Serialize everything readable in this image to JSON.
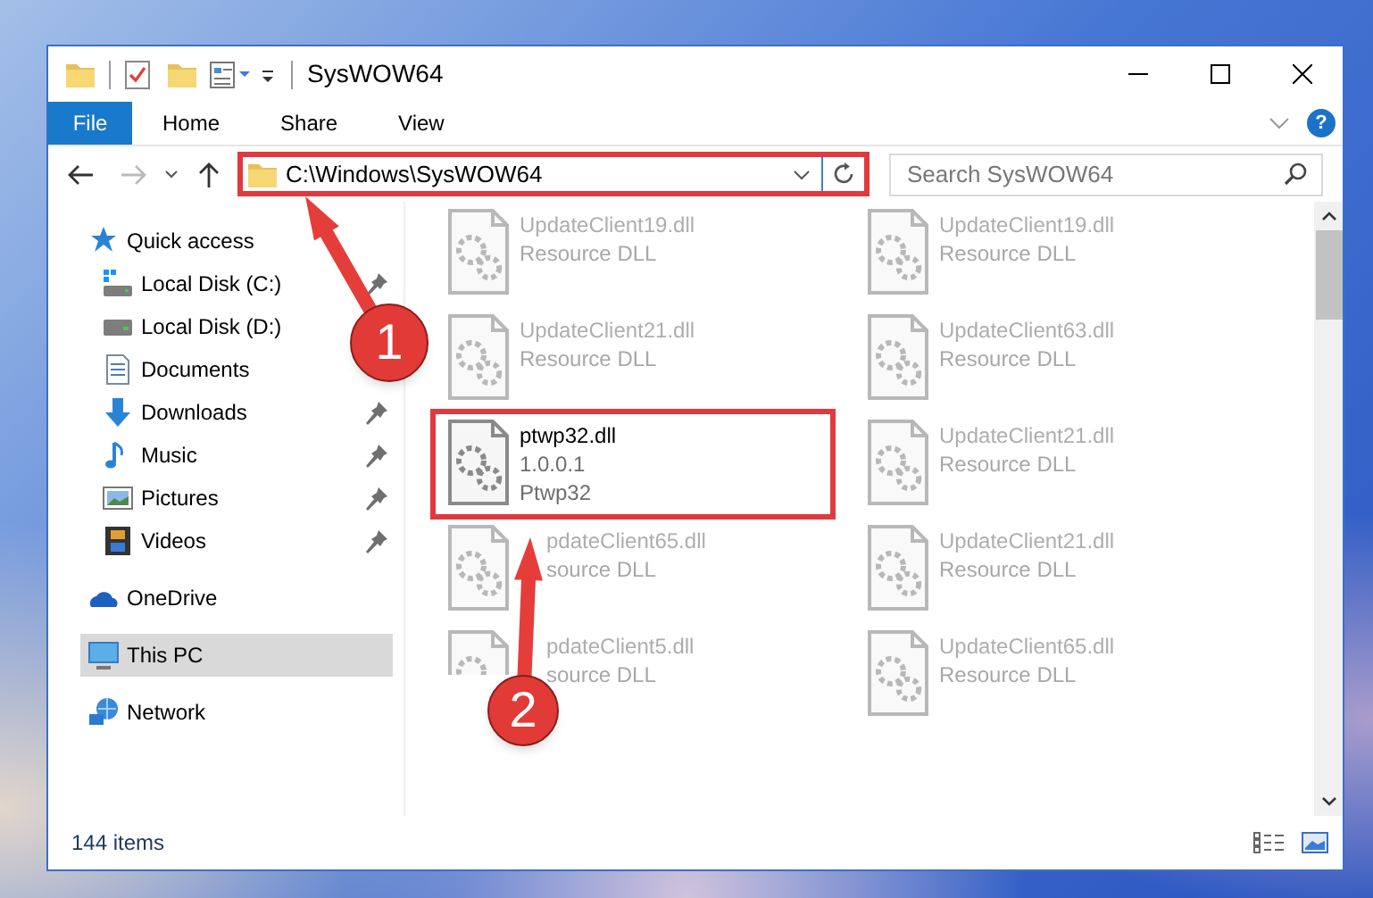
{
  "window": {
    "title": "SysWOW64",
    "help_button": "?"
  },
  "ribbon_tabs": [
    {
      "label": "File",
      "kind": "file"
    },
    {
      "label": "Home",
      "kind": "tab"
    },
    {
      "label": "Share",
      "kind": "tab"
    },
    {
      "label": "View",
      "kind": "tab"
    }
  ],
  "address_bar": {
    "path": "C:\\Windows\\SysWOW64",
    "highlighted": true
  },
  "search": {
    "placeholder": "Search SysWOW64"
  },
  "sidebar": [
    {
      "label": "Quick access",
      "kind": "star",
      "selected": false,
      "children": [
        {
          "label": "Local Disk (C:)",
          "kind": "windrive",
          "pinned": true,
          "selected": false
        },
        {
          "label": "Local Disk (D:)",
          "kind": "drive",
          "pinned": false,
          "selected": false
        },
        {
          "label": "Documents",
          "kind": "docs",
          "pinned": false,
          "selected": false
        },
        {
          "label": "Downloads",
          "kind": "download",
          "pinned": true,
          "selected": false
        },
        {
          "label": "Music",
          "kind": "music",
          "pinned": true,
          "selected": false
        },
        {
          "label": "Pictures",
          "kind": "pictures",
          "pinned": true,
          "selected": false
        },
        {
          "label": "Videos",
          "kind": "videos",
          "pinned": true,
          "selected": false
        }
      ]
    },
    {
      "label": "OneDrive",
      "kind": "cloud",
      "selected": false
    },
    {
      "label": "This PC",
      "kind": "pc",
      "selected": true
    },
    {
      "label": "Network",
      "kind": "network",
      "selected": false
    }
  ],
  "files": [
    {
      "name": "UpdateClient19.dll",
      "details": [
        "Resource DLL"
      ],
      "blurred": true,
      "highlighted": false
    },
    {
      "name": "UpdateClient19.dll",
      "details": [
        "Resource DLL"
      ],
      "blurred": true,
      "highlighted": false
    },
    {
      "name": "UpdateClient21.dll",
      "details": [
        "Resource DLL"
      ],
      "blurred": true,
      "highlighted": false
    },
    {
      "name": "UpdateClient63.dll",
      "details": [
        "Resource DLL"
      ],
      "blurred": true,
      "highlighted": false
    },
    {
      "name": "ptwp32.dll",
      "details": [
        "1.0.0.1",
        "Ptwp32"
      ],
      "blurred": false,
      "highlighted": true
    },
    {
      "name": "UpdateClient21.dll",
      "details": [
        "Resource DLL"
      ],
      "blurred": true,
      "highlighted": false
    },
    {
      "name": "pdateClient65.dll",
      "details": [
        "source DLL"
      ],
      "blurred": true,
      "highlighted": false,
      "kind": "under_arrow"
    },
    {
      "name": "UpdateClient21.dll",
      "details": [
        "Resource DLL"
      ],
      "blurred": true,
      "highlighted": false
    },
    {
      "name": "pdateClient5.dll",
      "details": [
        "source DLL"
      ],
      "blurred": true,
      "highlighted": false,
      "kind": "under_badge"
    },
    {
      "name": "UpdateClient65.dll",
      "details": [
        "Resource DLL"
      ],
      "blurred": true,
      "highlighted": false
    }
  ],
  "status_bar": {
    "item_count": "144 items"
  },
  "callouts": [
    {
      "number": "1"
    },
    {
      "number": "2"
    }
  ]
}
